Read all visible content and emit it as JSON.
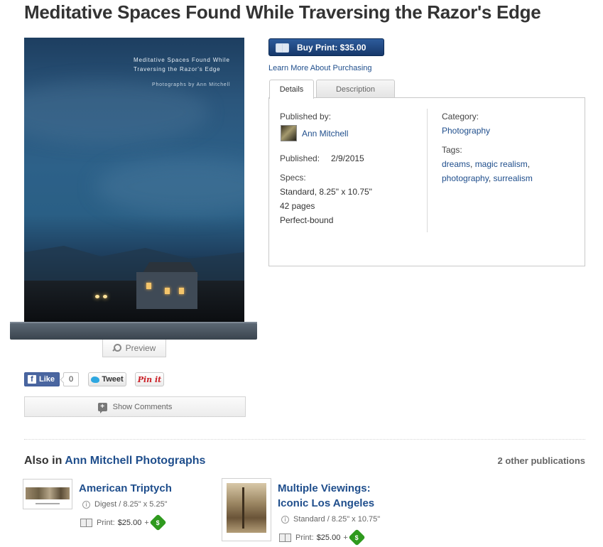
{
  "book": {
    "title": "Meditative Spaces Found While Traversing the Razor's Edge",
    "cover_title_line1": "Meditative Spaces Found While",
    "cover_title_line2": "Traversing the Razor's Edge",
    "cover_subtitle": "Photographs by Ann Mitchell"
  },
  "preview_label": "Preview",
  "social": {
    "fb_like_label": "Like",
    "fb_count": "0",
    "tweet_label": "Tweet",
    "pin_label": "Pin it"
  },
  "show_comments_label": "Show Comments",
  "buy": {
    "label": "Buy Print: $35.00",
    "learn_more": "Learn More About Purchasing"
  },
  "tabs": [
    "Details",
    "Description"
  ],
  "details": {
    "published_by_label": "Published by:",
    "author": "Ann Mitchell",
    "published_label": "Published:",
    "published_date": "2/9/2015",
    "specs_label": "Specs:",
    "specs": [
      "Standard, 8.25\" x 10.75\"",
      "42 pages",
      "Perfect-bound"
    ],
    "category_label": "Category:",
    "category": "Photography",
    "tags_label": "Tags:",
    "tags": [
      "dreams",
      "magic realism",
      "photography",
      "surrealism"
    ]
  },
  "also_in": {
    "prefix": "Also in",
    "collection": "Ann Mitchell Photographs",
    "count_label": "2 other publications",
    "items": [
      {
        "title": "American Triptych",
        "spec": "Digest / 8.25\" x 5.25\"",
        "price_label": "Print:",
        "price": "$25.00",
        "plus": "+"
      },
      {
        "title_line1": "Multiple Viewings:",
        "title_line2": "Iconic Los Angeles",
        "spec": "Standard / 8.25\" x 10.75\"",
        "price_label": "Print:",
        "price": "$25.00",
        "plus": "+"
      }
    ]
  },
  "colors": {
    "link": "#1f4e8c",
    "buy_button": "#17386a",
    "badge": "#2f9a1e"
  }
}
